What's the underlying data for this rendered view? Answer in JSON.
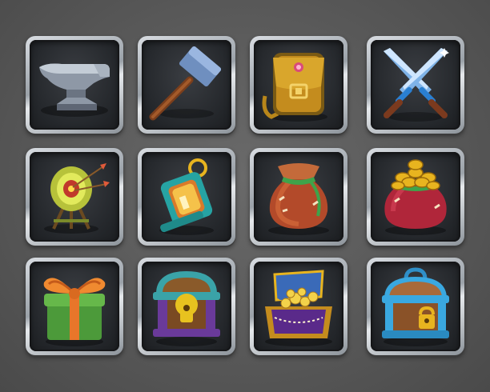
{
  "inventory": {
    "slots": [
      {
        "id": "anvil",
        "icon": "anvil-icon"
      },
      {
        "id": "hammer",
        "icon": "hammer-icon"
      },
      {
        "id": "backpack",
        "icon": "backpack-icon"
      },
      {
        "id": "crossed-swords",
        "icon": "crossed-swords-icon"
      },
      {
        "id": "archery-target",
        "icon": "archery-target-icon"
      },
      {
        "id": "lantern",
        "icon": "lantern-icon"
      },
      {
        "id": "sack",
        "icon": "sack-icon"
      },
      {
        "id": "gold-sack",
        "icon": "gold-sack-icon"
      },
      {
        "id": "gift-box",
        "icon": "gift-box-icon"
      },
      {
        "id": "locked-chest",
        "icon": "locked-chest-icon"
      },
      {
        "id": "treasure-chest",
        "icon": "treasure-chest-icon"
      },
      {
        "id": "padlock-chest",
        "icon": "padlock-chest-icon"
      }
    ]
  },
  "colors": {
    "background": "#595959",
    "slot_frame": "#b4bac0",
    "slot_inner": "#26292d",
    "gold": "#e8b41f"
  }
}
